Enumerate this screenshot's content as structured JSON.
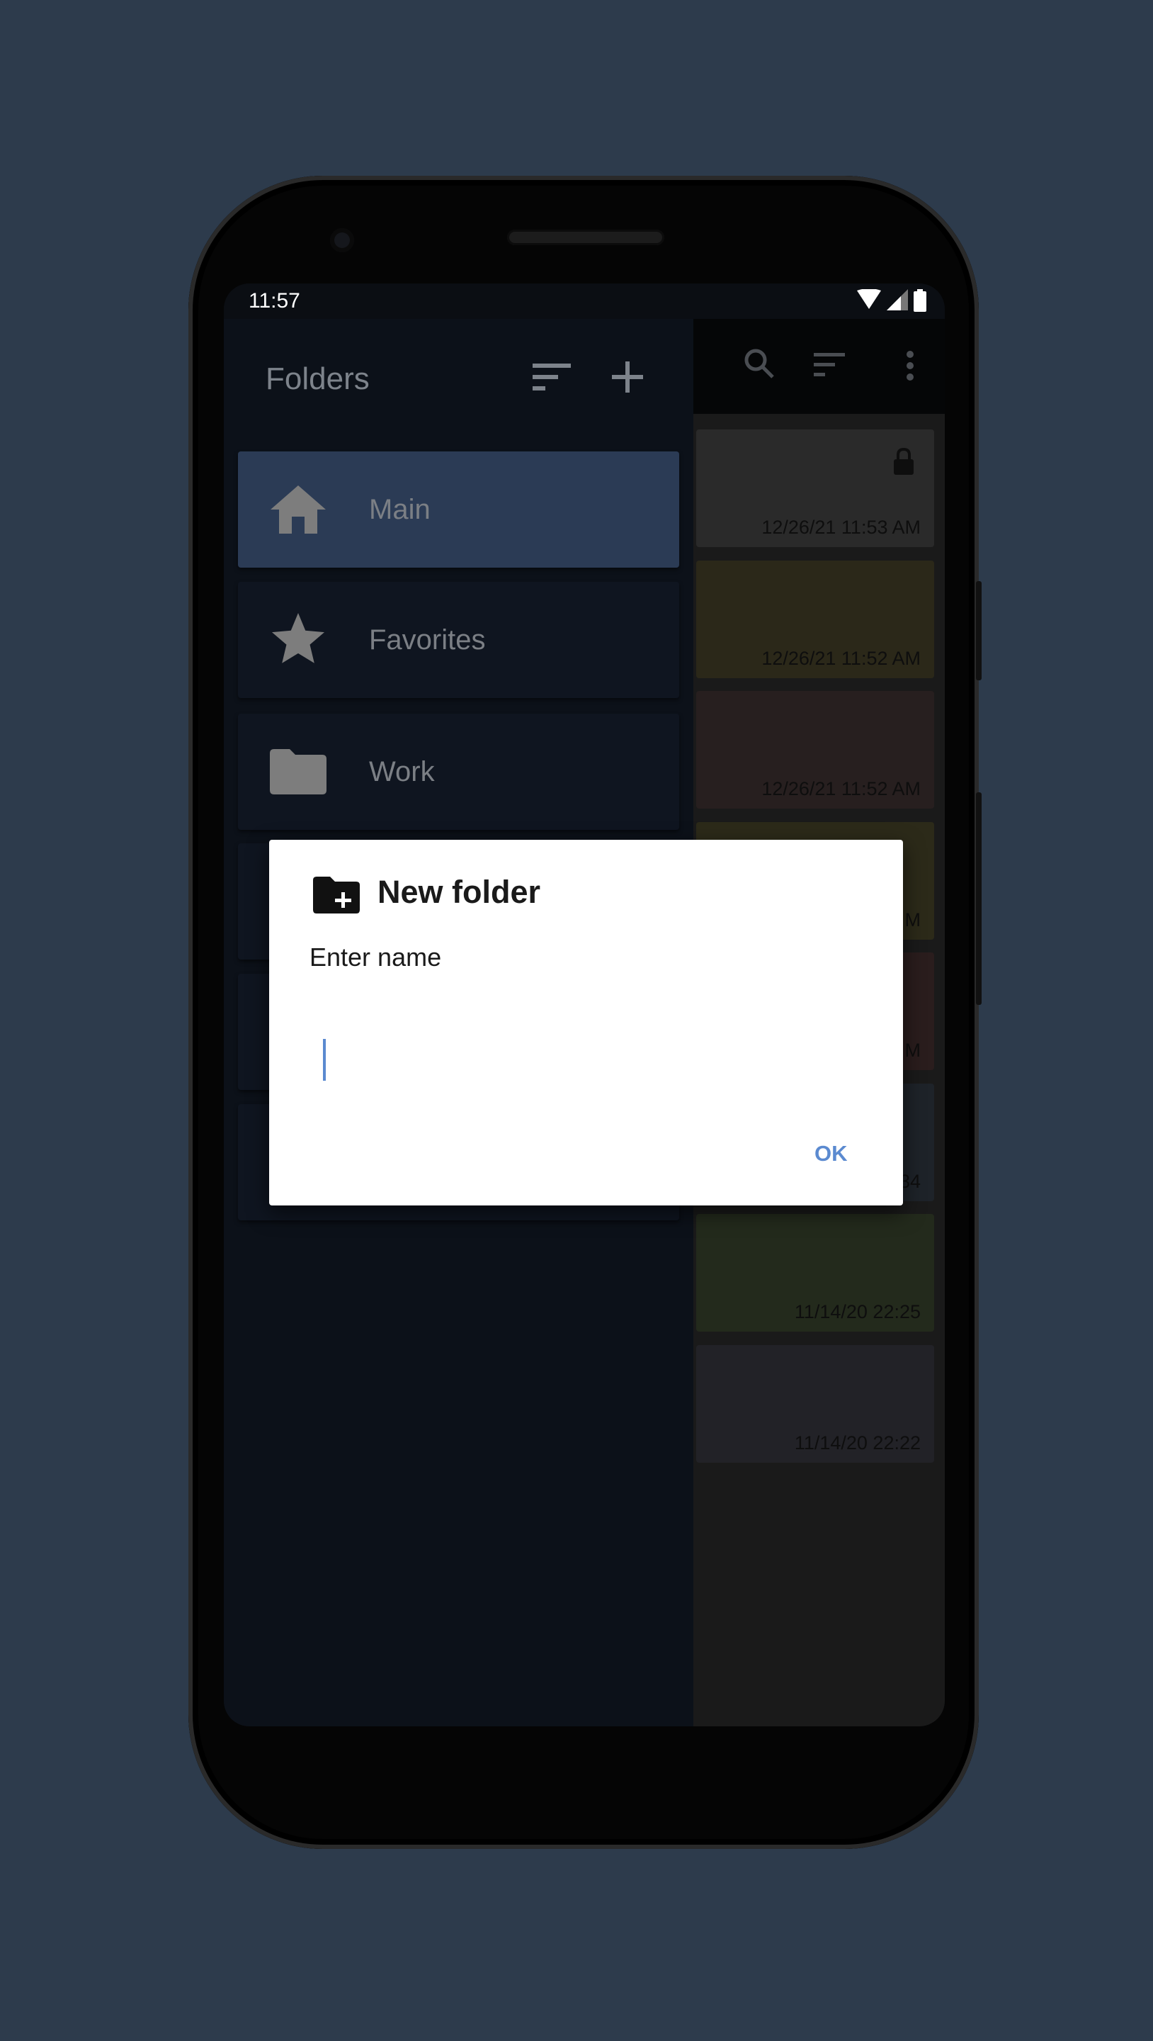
{
  "status_bar": {
    "time": "11:57"
  },
  "drawer": {
    "title": "Folders",
    "folders": [
      {
        "label": "Main",
        "icon": "home-icon",
        "selected": true
      },
      {
        "label": "Favorites",
        "icon": "star-icon"
      },
      {
        "label": "Work",
        "icon": "folder-icon"
      }
    ]
  },
  "notes": [
    {
      "date": "12/26/21   11:53 AM",
      "color": "#2a2a2a",
      "locked": true
    },
    {
      "date": "12/26/21   11:52 AM",
      "color": "#2b2819"
    },
    {
      "date": "12/26/21   11:52 AM",
      "color": "#271f1f"
    },
    {
      "date": "M",
      "color": "#2c2a19"
    },
    {
      "date": "M",
      "color": "#2a1d1d"
    },
    {
      "date": "34",
      "color": "#1e2329"
    },
    {
      "date": "11/14/20   22:25",
      "color": "#232a1c"
    },
    {
      "date": "11/14/20   22:22",
      "color": "#222227"
    }
  ],
  "dialog": {
    "title": "New folder",
    "label": "Enter name",
    "input_value": "",
    "ok_label": "OK",
    "accent": "#5b8ad0"
  },
  "fab": {
    "label": "+"
  }
}
